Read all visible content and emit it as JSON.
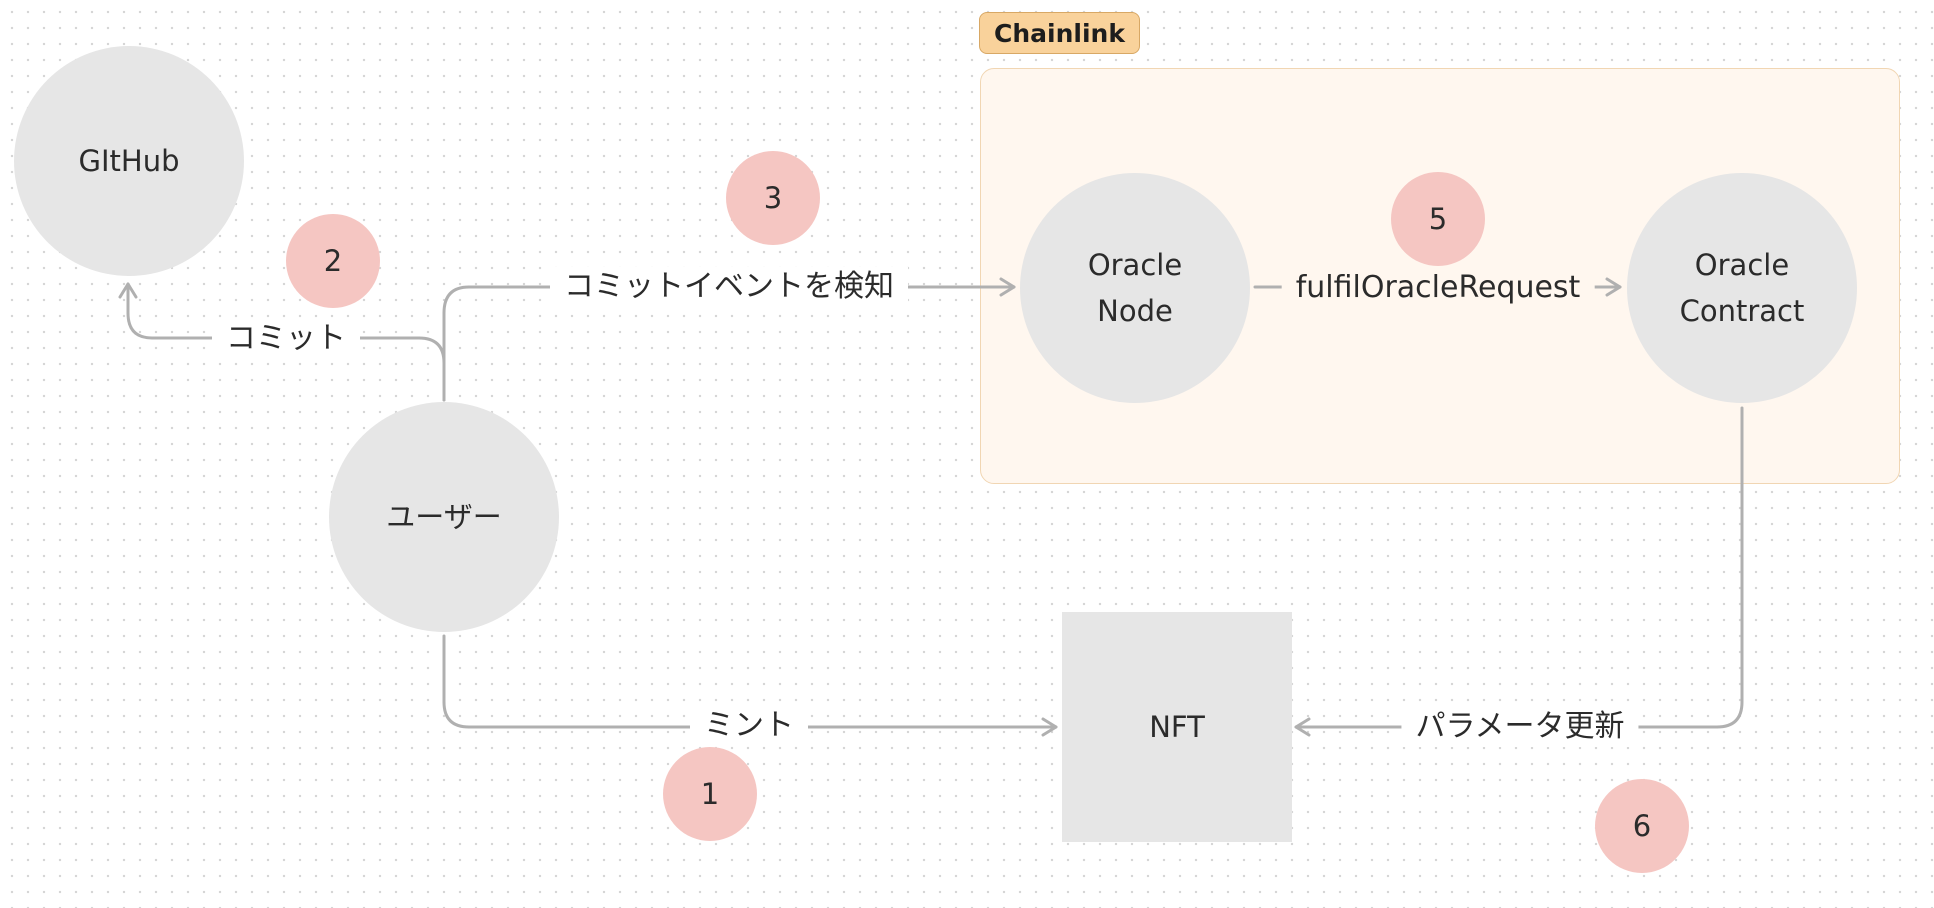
{
  "group": {
    "label": "Chainlink"
  },
  "nodes": {
    "github": "GItHub",
    "user": "ユーザー",
    "oracle_node": "Oracle\nNode",
    "oracle_contract": "Oracle\nContract",
    "nft": "NFT"
  },
  "edges": {
    "commit": "コミット",
    "detect": "コミットイベントを検知",
    "fulfil": "fulfilOracleRequest",
    "mint": "ミント",
    "update": "パラメータ更新"
  },
  "badges": [
    "1",
    "2",
    "3",
    "5",
    "6"
  ],
  "colors": {
    "node_fill": "#e6e6e6",
    "badge_fill": "#f5c6c2",
    "group_fill": "#fff7ef",
    "group_tag_fill": "#f9d29b",
    "edge": "#b0b0b0"
  }
}
